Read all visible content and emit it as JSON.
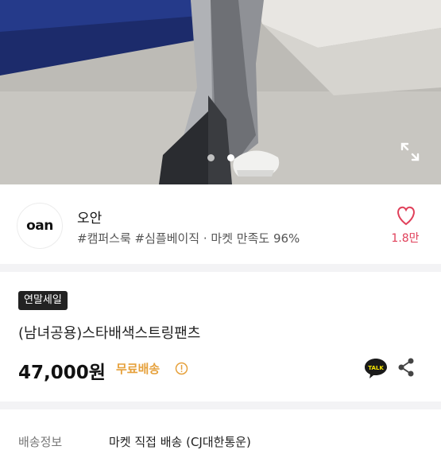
{
  "hero": {
    "image_alt": "product-photo",
    "carousel_count": 2,
    "active_index": 1
  },
  "seller": {
    "logo_text": "oan",
    "name": "오안",
    "tags": "#캠퍼스룩 #심플베이직 · 마켓 만족도 96%",
    "likes": "1.8만"
  },
  "product": {
    "badge": "연말세일",
    "title": "(남녀공용)스타배색스트링팬츠",
    "price": "47,000원",
    "shipping": "무료배송",
    "talk_label": "TALK"
  },
  "info_row": {
    "label": "배송정보",
    "value": "마켓 직접 배송 (CJ대한통운)"
  },
  "colors": {
    "accent": "#e0405a",
    "shipping": "#e6a13c",
    "badge_bg": "#222222"
  }
}
